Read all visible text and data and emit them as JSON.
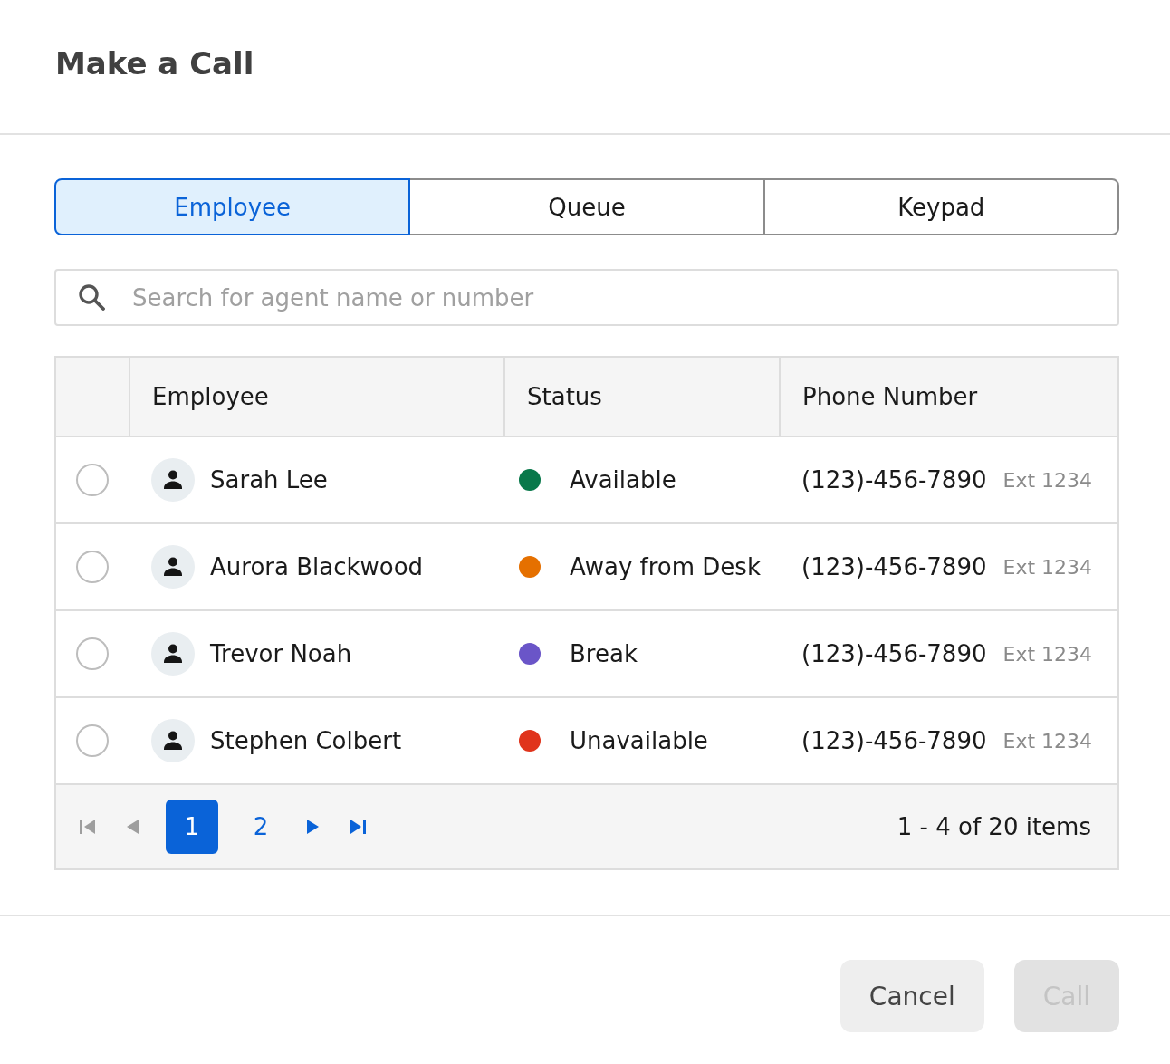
{
  "dialog": {
    "title": "Make a Call"
  },
  "tabs": [
    {
      "label": "Employee",
      "selected": true
    },
    {
      "label": "Queue",
      "selected": false
    },
    {
      "label": "Keypad",
      "selected": false
    }
  ],
  "search": {
    "placeholder": "Search for agent name or number"
  },
  "table": {
    "columns": [
      "Employee",
      "Status",
      "Phone Number"
    ],
    "rows": [
      {
        "selected": false,
        "name": "Sarah Lee",
        "status": "Available",
        "color": "#08784a",
        "phone": "(123)-456-7890",
        "extension": "Ext 1234"
      },
      {
        "selected": false,
        "name": "Aurora Blackwood",
        "status": "Away from Desk",
        "color": "#e57000",
        "phone": "(123)-456-7890",
        "extension": "Ext 1234"
      },
      {
        "selected": false,
        "name": "Trevor Noah",
        "status": "Break",
        "color": "#6a55c8",
        "phone": "(123)-456-7890",
        "extension": "Ext 1234"
      },
      {
        "selected": false,
        "name": "Stephen Colbert",
        "status": "Unavailable",
        "color": "#e0341c",
        "phone": "(123)-456-7890",
        "extension": "Ext 1234"
      }
    ]
  },
  "pagination": {
    "nav": [
      {
        "kind": "first",
        "disabled": true
      },
      {
        "kind": "prev",
        "disabled": true
      },
      {
        "kind": "next",
        "disabled": false
      },
      {
        "kind": "last",
        "disabled": false
      }
    ],
    "pages": [
      {
        "label": "1",
        "selected": true
      },
      {
        "label": "2",
        "selected": false
      }
    ],
    "summary": "1 - 4 of 20 items"
  },
  "buttons": [
    {
      "label": "Cancel",
      "disabled": false
    },
    {
      "label": "Call",
      "disabled": true
    }
  ]
}
